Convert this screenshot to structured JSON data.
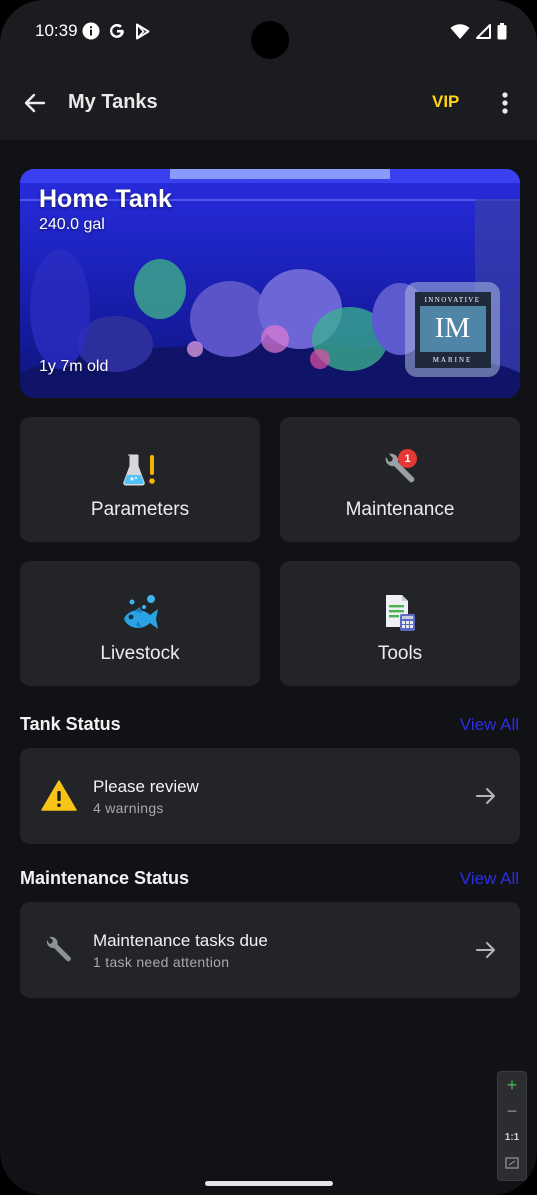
{
  "status_bar": {
    "time": "10:39"
  },
  "app_bar": {
    "title": "My Tanks",
    "vip_label": "VIP"
  },
  "tank": {
    "name": "Home Tank",
    "volume": "240.0 gal",
    "age": "1y 7m old",
    "logo": {
      "top_text": "INNOVATIVE",
      "mid_text": "IM",
      "bottom_text": "MARINE"
    }
  },
  "tiles": [
    {
      "label": "Parameters",
      "icon": "flask-icon"
    },
    {
      "label": "Maintenance",
      "icon": "wrench-icon",
      "badge": "1"
    },
    {
      "label": "Livestock",
      "icon": "fish-icon"
    },
    {
      "label": "Tools",
      "icon": "calculator-sheet-icon"
    }
  ],
  "tank_status": {
    "title": "Tank Status",
    "view_all": "View All",
    "card_title": "Please review",
    "card_sub": "4 warnings"
  },
  "maintenance_status": {
    "title": "Maintenance Status",
    "view_all": "View All",
    "card_title": "Maintenance tasks due",
    "card_sub": "1 task need attention"
  },
  "zoom": {
    "plus": "+",
    "minus": "−",
    "reset": "1:1"
  },
  "colors": {
    "vip": "#ffd31a",
    "link": "#2b2ee6",
    "warning": "#f7c417",
    "badge": "#e53935",
    "card_bg": "#232427",
    "app_bg": "#111215"
  }
}
